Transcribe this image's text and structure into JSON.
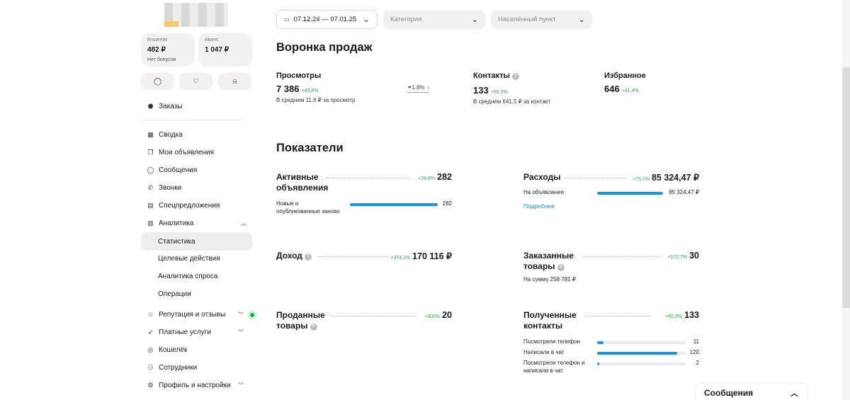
{
  "sidebar": {
    "wallet": {
      "label": "Кошелёк",
      "value": "482 ₽",
      "sub": "Нет бонусов"
    },
    "advance": {
      "label": "Аванс",
      "value": "1 047 ₽"
    },
    "orders": "Заказы",
    "items": [
      {
        "label": "Сводка",
        "icon": "grid-icon",
        "glyph": "▦"
      },
      {
        "label": "Мои объявления",
        "icon": "copy-icon",
        "glyph": "❐"
      },
      {
        "label": "Сообщения",
        "icon": "chat-icon",
        "glyph": "◯"
      },
      {
        "label": "Звонки",
        "icon": "phone-icon",
        "glyph": "✆"
      },
      {
        "label": "Спецпредложения",
        "icon": "offers-icon",
        "glyph": "▤"
      },
      {
        "label": "Аналитика",
        "icon": "analytics-icon",
        "glyph": "▥"
      },
      {
        "label": "Статистика"
      },
      {
        "label": "Целевые действия"
      },
      {
        "label": "Аналитика спроса"
      },
      {
        "label": "Операции"
      },
      {
        "label": "Репутация и отзывы",
        "icon": "star-icon",
        "glyph": "☆"
      },
      {
        "label": "Платные услуги",
        "icon": "rocket-icon",
        "glyph": "➶"
      },
      {
        "label": "Кошелёк",
        "icon": "wallet-icon",
        "glyph": "◎"
      },
      {
        "label": "Сотрудники",
        "icon": "people-icon",
        "glyph": "⚇"
      },
      {
        "label": "Профиль и настройки",
        "icon": "settings-icon",
        "glyph": "⚙"
      }
    ]
  },
  "filters": {
    "dates": "07.12.24 — 07.01.25",
    "category": "Категория",
    "city": "Населённый пункт"
  },
  "funnel": {
    "title": "Воронка продаж",
    "views": {
      "label": "Просмотры",
      "value": "7 386",
      "delta": "+43,8%",
      "note": "В среднем 11,6 ₽ за просмотр"
    },
    "conversion": "1,8%",
    "contacts": {
      "label": "Контакты",
      "value": "133",
      "delta": "+66,3%",
      "note": "В среднем 641,5 ₽ за контакт"
    },
    "favorites": {
      "label": "Избранное",
      "value": "646",
      "delta": "+41,4%"
    }
  },
  "indicators": {
    "title": "Показатели",
    "active": {
      "name": "Активные объявления",
      "delta": "+24,8%",
      "value": "282",
      "row_label": "Новые и опубликованные заново",
      "row_value": "282",
      "row_fill": 1.0
    },
    "expenses": {
      "name": "Расходы",
      "delta": "+75,1%",
      "value": "85 324,47 ₽",
      "row_label": "На объявления",
      "row_value": "85 324,47 ₽",
      "row_fill": 1.0,
      "link": "Подробнее"
    },
    "income": {
      "name": "Доход",
      "delta": "+374,1%",
      "value": "170 116 ₽"
    },
    "ordered": {
      "name": "Заказанные товары",
      "delta": "+172,7%",
      "value": "30",
      "note": "На сумму 258 781 ₽"
    },
    "sold": {
      "name": "Проданные товары",
      "delta": "+300%",
      "value": "20"
    },
    "received": {
      "name": "Полученные контакты",
      "delta": "+66,3%",
      "value": "133",
      "rows": [
        {
          "label": "Посмотрели телефон",
          "value": "11",
          "fill": 0.07
        },
        {
          "label": "Написали в чат",
          "value": "120",
          "fill": 0.9
        },
        {
          "label": "Посмотрели телефон и написали в чат",
          "value": "2",
          "fill": 0.02
        }
      ]
    }
  },
  "messages_panel": "Сообщения",
  "colors": {
    "accent": "#1595e3",
    "positive": "#2aa84a",
    "link": "#1d8fe0"
  }
}
